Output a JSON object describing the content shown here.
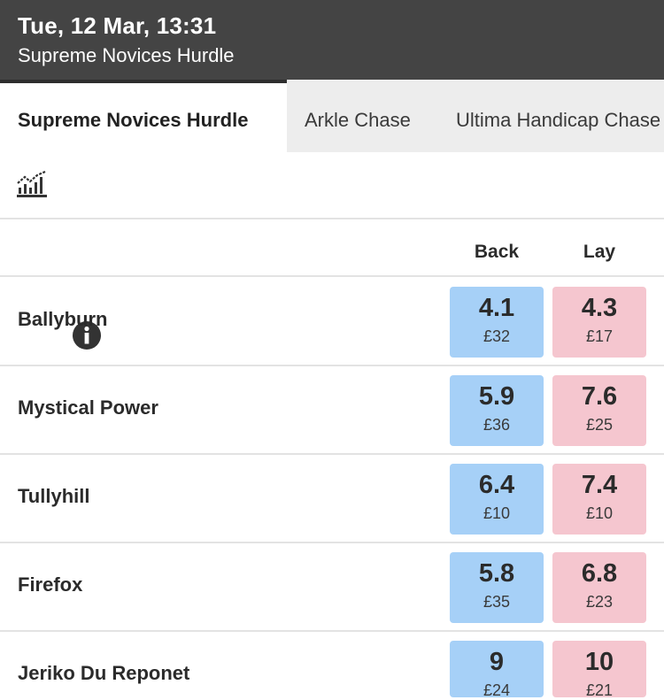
{
  "header": {
    "datetime": "Tue, 12 Mar, 13:31",
    "race": "Supreme Novices Hurdle"
  },
  "tabs": [
    {
      "label": "Supreme Novices Hurdle",
      "active": true
    },
    {
      "label": "Arkle Chase",
      "active": false
    },
    {
      "label": "Ultima Handicap Chase",
      "active": false
    }
  ],
  "toolbar": {
    "chart_icon": "bar-chart-trend-icon",
    "info_icon": "info-icon"
  },
  "columns": {
    "back": "Back",
    "lay": "Lay"
  },
  "runners": [
    {
      "name": "Ballyburn",
      "back_odds": "4.1",
      "back_stake": "£32",
      "lay_odds": "4.3",
      "lay_stake": "£17"
    },
    {
      "name": "Mystical Power",
      "back_odds": "5.9",
      "back_stake": "£36",
      "lay_odds": "7.6",
      "lay_stake": "£25"
    },
    {
      "name": "Tullyhill",
      "back_odds": "6.4",
      "back_stake": "£10",
      "lay_odds": "7.4",
      "lay_stake": "£10"
    },
    {
      "name": "Firefox",
      "back_odds": "5.8",
      "back_stake": "£35",
      "lay_odds": "6.8",
      "lay_stake": "£23"
    },
    {
      "name": "Jeriko Du Reponet",
      "back_odds": "9",
      "back_stake": "£24",
      "lay_odds": "10",
      "lay_stake": "£21"
    }
  ],
  "colors": {
    "header_bg": "#444444",
    "back": "#a6d0f7",
    "lay": "#f5c6cf"
  }
}
